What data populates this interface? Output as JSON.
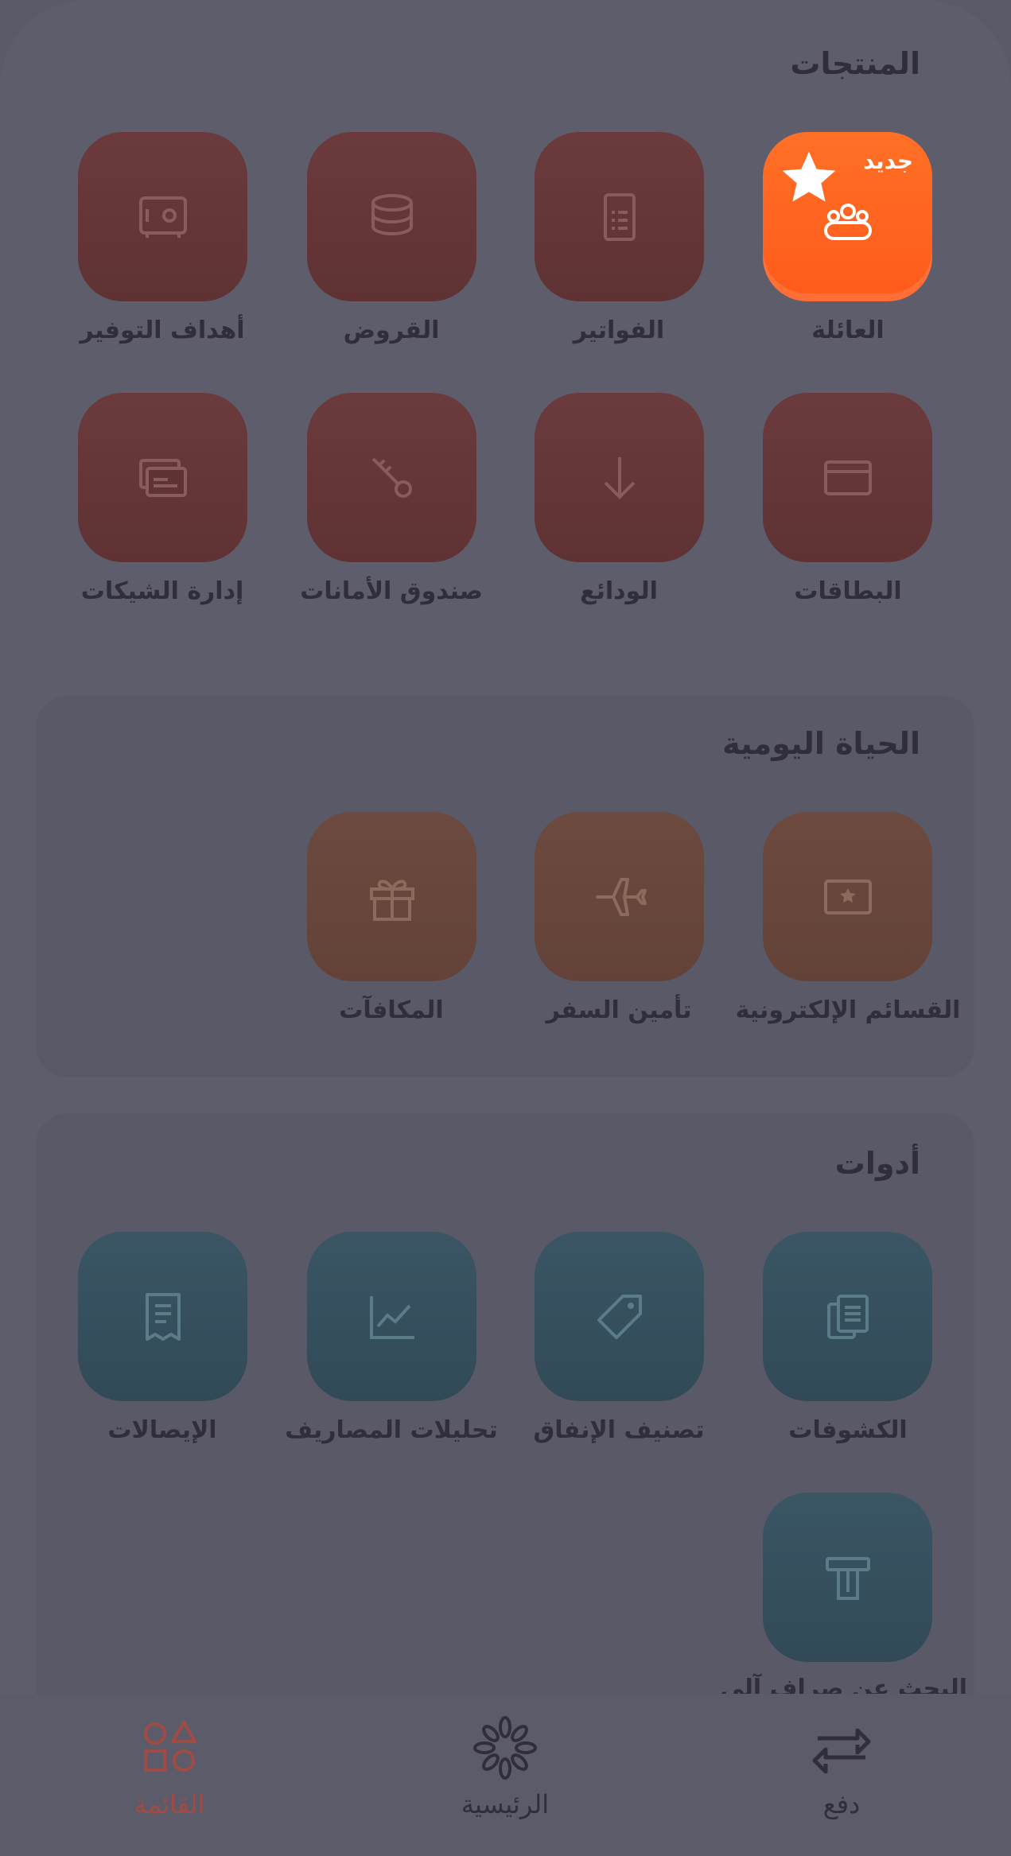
{
  "sections": {
    "products": {
      "title": "المنتجات",
      "items": [
        {
          "label": "العائلة",
          "icon": "family-icon",
          "badge": "جديد"
        },
        {
          "label": "الفواتير",
          "icon": "bill-icon"
        },
        {
          "label": "القروض",
          "icon": "coins-icon"
        },
        {
          "label": "أهداف التوفير",
          "icon": "safe-icon"
        },
        {
          "label": "البطاقات",
          "icon": "card-icon"
        },
        {
          "label": "الودائع",
          "icon": "arrow-down-icon"
        },
        {
          "label": "صندوق الأمانات",
          "icon": "key-icon"
        },
        {
          "label": "إدارة الشيكات",
          "icon": "cheques-icon"
        }
      ]
    },
    "daily_life": {
      "title": "الحياة اليومية",
      "items": [
        {
          "label": "القسائم الإلكترونية",
          "icon": "voucher-icon"
        },
        {
          "label": "تأمين السفر",
          "icon": "airplane-icon"
        },
        {
          "label": "المكافآت",
          "icon": "gift-icon"
        }
      ]
    },
    "tools": {
      "title": "أدوات",
      "items": [
        {
          "label": "الكشوفات",
          "icon": "statements-icon"
        },
        {
          "label": "تصنيف الإنفاق",
          "icon": "tag-icon"
        },
        {
          "label": "تحليلات المصاريف",
          "icon": "chart-icon"
        },
        {
          "label": "الإيصالات",
          "icon": "receipt-icon"
        },
        {
          "label": "البحث عن صراف آلي",
          "icon": "atm-icon"
        }
      ]
    }
  },
  "bottom_nav": {
    "items": [
      {
        "label": "القائمة",
        "icon": "menu-shapes-icon",
        "active": true
      },
      {
        "label": "الرئيسية",
        "icon": "home-logo-icon",
        "active": false
      },
      {
        "label": "دفع",
        "icon": "transfer-icon",
        "active": false
      }
    ]
  },
  "colors": {
    "accent": "#ff6a22",
    "active_nav": "#a24a44",
    "inactive_nav": "#2f2e3a"
  }
}
